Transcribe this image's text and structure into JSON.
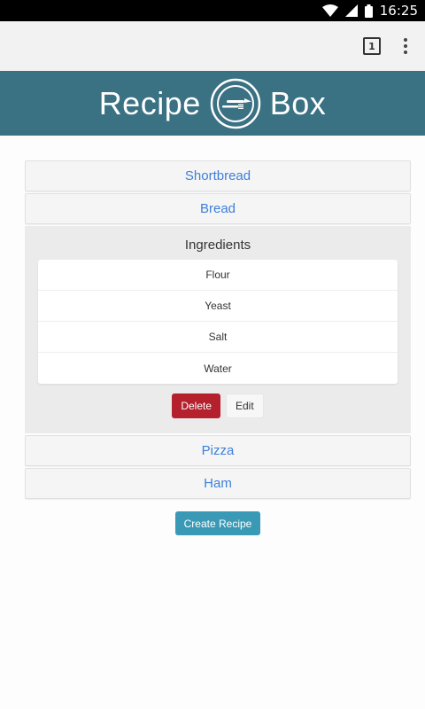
{
  "statusbar": {
    "time": "16:25",
    "icons": [
      "wifi-icon",
      "signal-icon",
      "battery-icon"
    ]
  },
  "toolbar": {
    "tab_count": "1",
    "icons": [
      "tabs-icon",
      "overflow-menu-icon"
    ]
  },
  "header": {
    "title_left": "Recipe",
    "title_right": "Box",
    "logo_icon": "fork-knife-plate-icon",
    "background": "#3a7183"
  },
  "recipes": [
    {
      "name": "Shortbread"
    },
    {
      "name": "Bread"
    },
    {
      "name": "Pizza"
    },
    {
      "name": "Ham"
    }
  ],
  "expanded": {
    "ingredients_title": "Ingredients",
    "ingredients": [
      "Flour",
      "Yeast",
      "Salt",
      "Water"
    ],
    "delete_label": "Delete",
    "edit_label": "Edit"
  },
  "create_label": "Create Recipe",
  "colors": {
    "link": "#3d7fd9",
    "delete": "#b5202d",
    "create": "#3a9ab6"
  }
}
